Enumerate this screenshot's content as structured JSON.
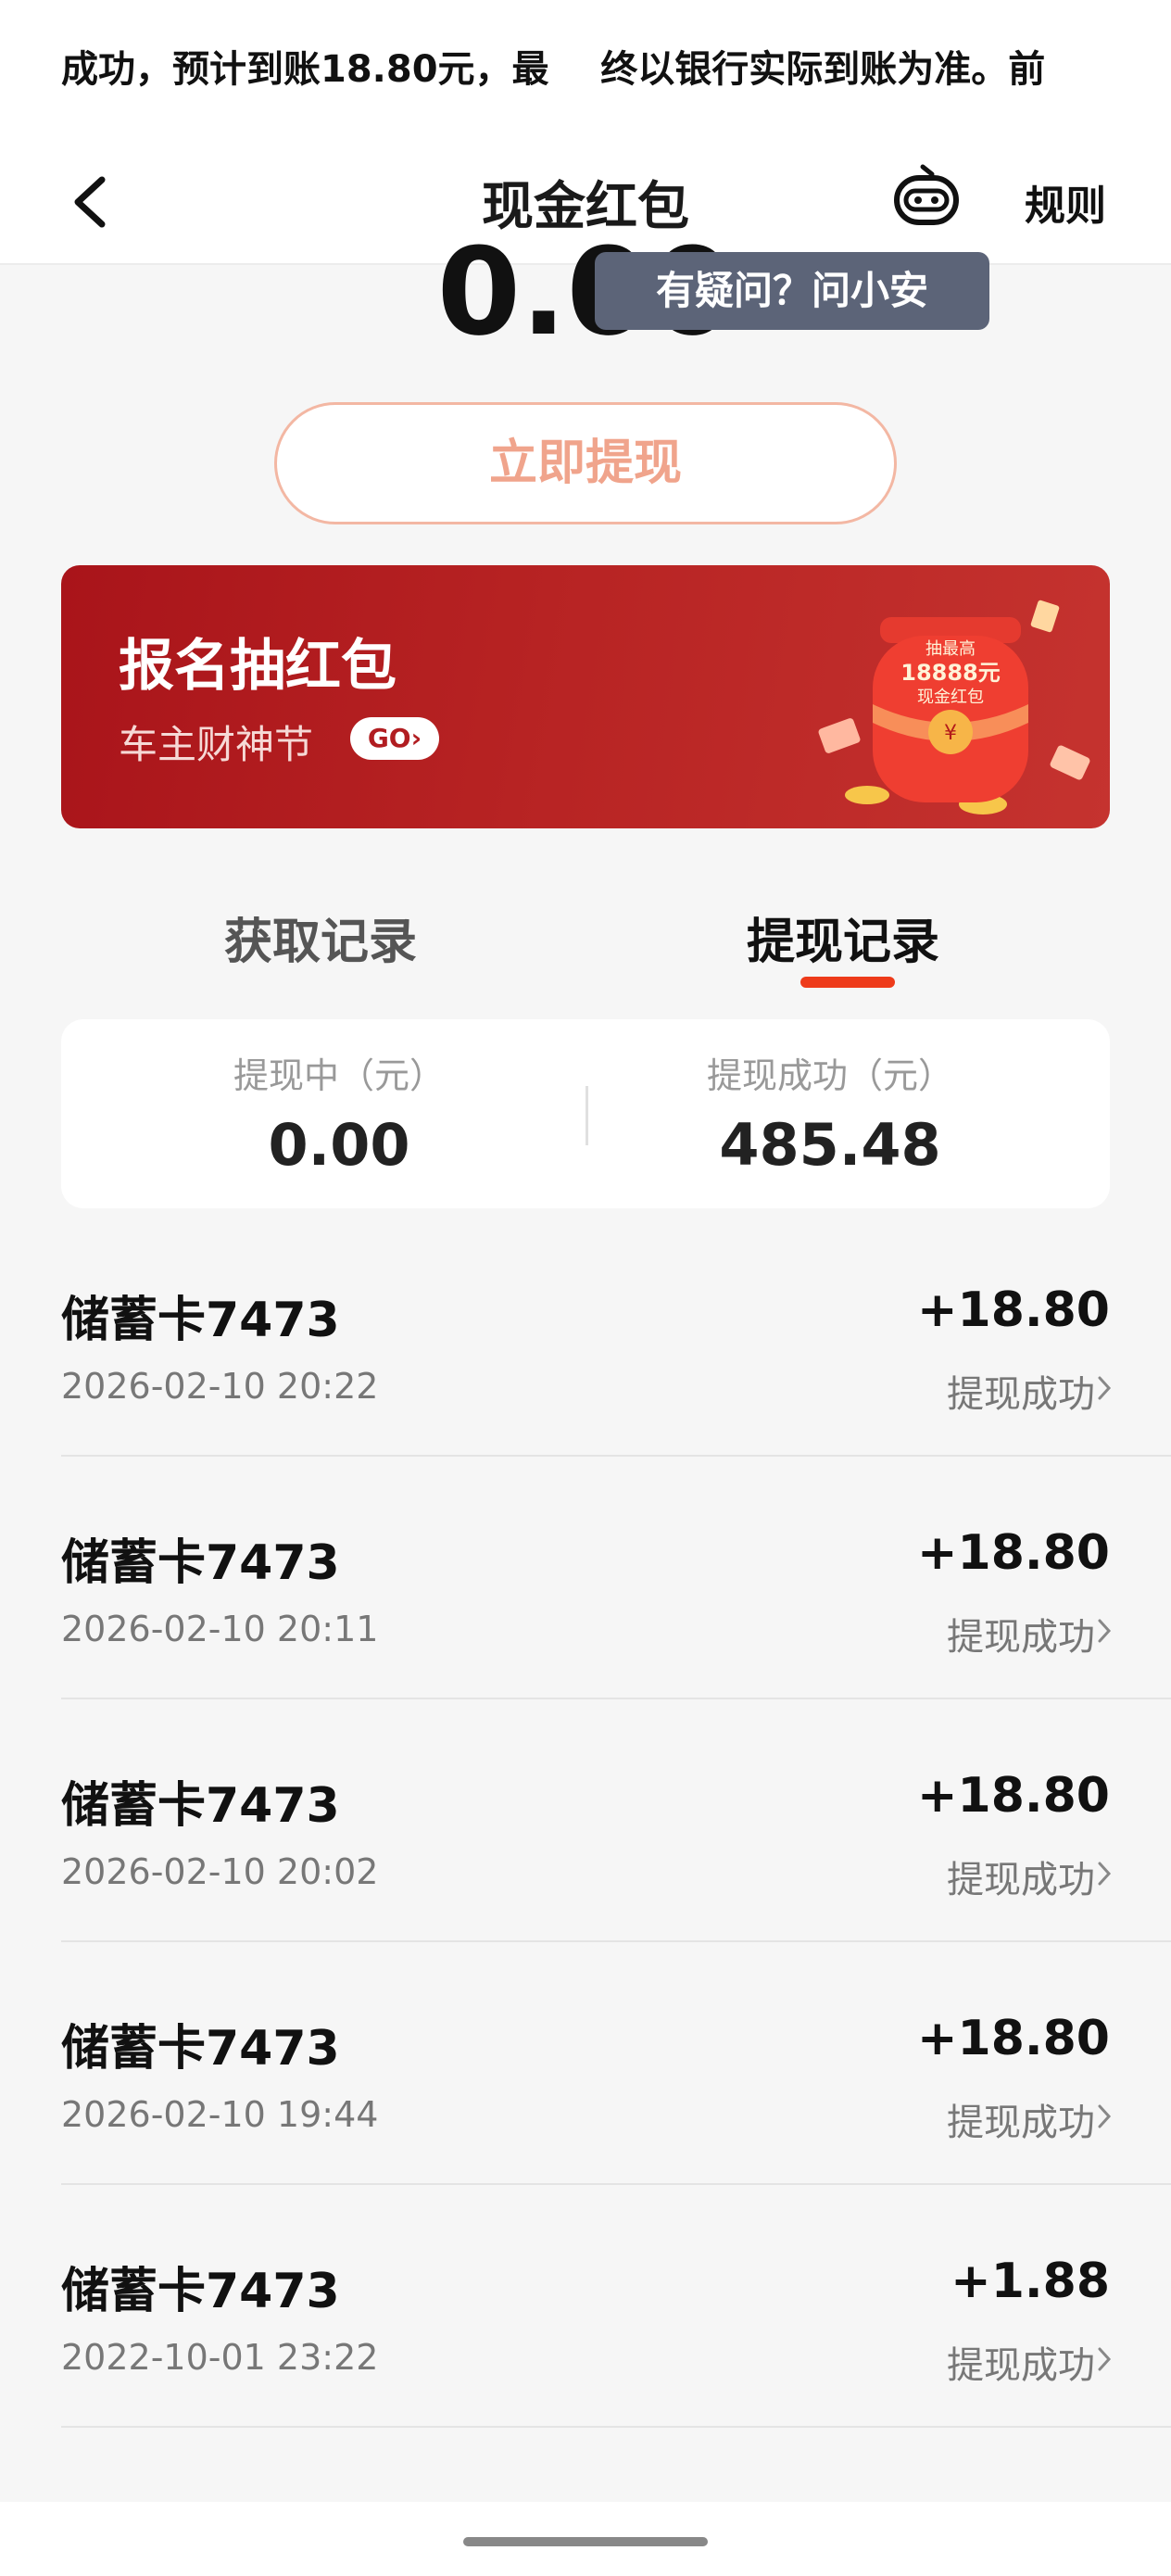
{
  "banner": {
    "text": "成功，预计到账18.80元，最    终以银行实际到账为准。前"
  },
  "header": {
    "title": "现金红包",
    "rules": "规则",
    "assistant_tooltip": "有疑问？问小安"
  },
  "balance": {
    "amount": "0.00",
    "withdraw_button": "立即提现"
  },
  "promo": {
    "title": "报名抽红包",
    "subtitle": "车主财神节",
    "go": "GO›",
    "lantern_text": [
      "抽最高",
      "18888元",
      "现金红包"
    ]
  },
  "tabs": [
    {
      "label": "获取记录",
      "active": false
    },
    {
      "label": "提现记录",
      "active": true
    }
  ],
  "summary": {
    "pending_label": "提现中（元）",
    "pending_value": "0.00",
    "success_label": "提现成功（元）",
    "success_value": "485.48"
  },
  "records": [
    {
      "title": "储蓄卡7473",
      "time": "2026-02-10 20:22",
      "amount": "+18.80",
      "status": "提现成功"
    },
    {
      "title": "储蓄卡7473",
      "time": "2026-02-10 20:11",
      "amount": "+18.80",
      "status": "提现成功"
    },
    {
      "title": "储蓄卡7473",
      "time": "2026-02-10 20:02",
      "amount": "+18.80",
      "status": "提现成功"
    },
    {
      "title": "储蓄卡7473",
      "time": "2026-02-10 19:44",
      "amount": "+18.80",
      "status": "提现成功"
    },
    {
      "title": "储蓄卡7473",
      "time": "2022-10-01 23:22",
      "amount": "+1.88",
      "status": "提现成功"
    }
  ],
  "colors": {
    "accent": "#ee3b1a",
    "promo_red": "#b72323",
    "button_border": "#f3b7a3"
  }
}
